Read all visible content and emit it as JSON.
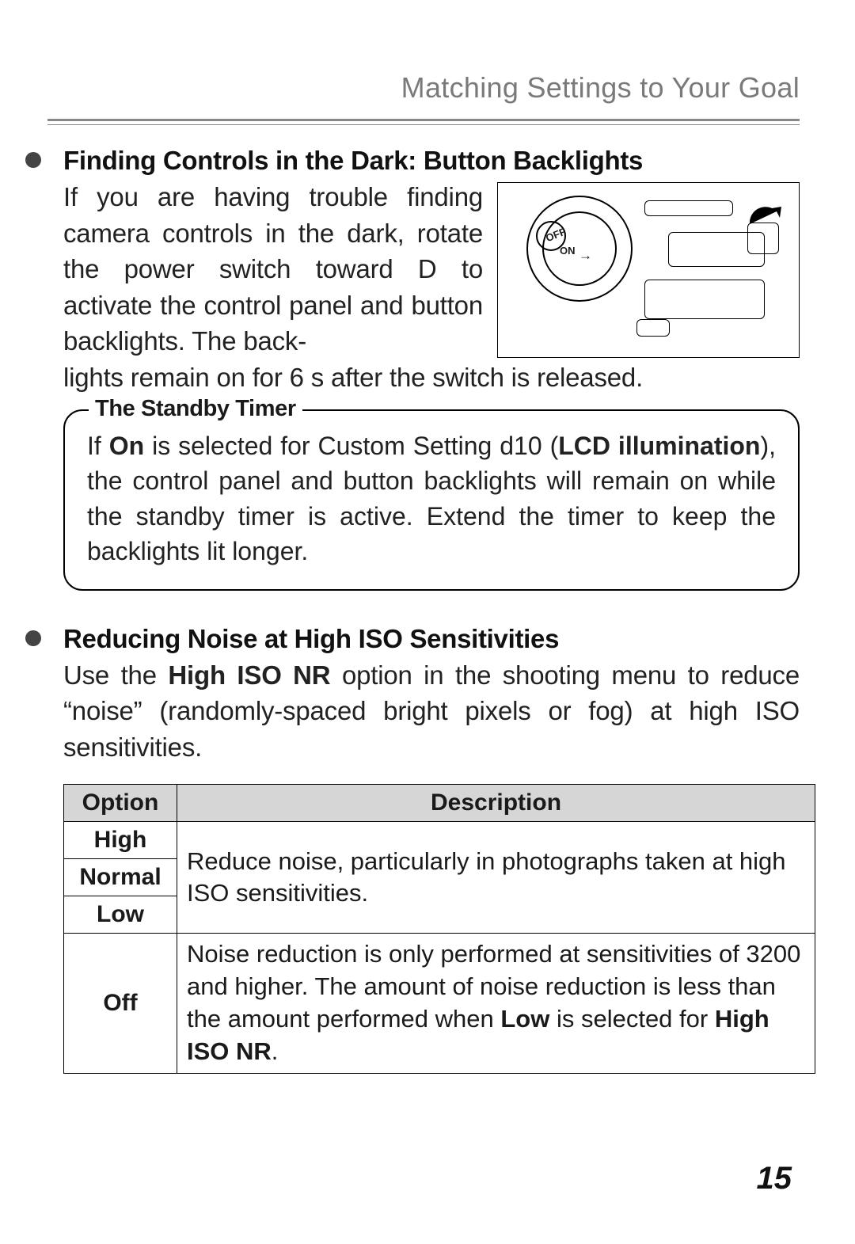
{
  "header": {
    "title": "Matching Settings to Your Goal"
  },
  "section1": {
    "title": "Finding Controls in the Dark: Button Backlights",
    "para1": "If you are having trouble finding camera controls in the dark, rotate the power switch toward D to activate the control panel and button backlights. The back-",
    "para2": "lights remain on for 6 s after the switch is released.",
    "fig_labels": {
      "off": "OFF",
      "on": "ON",
      "arrow": "→"
    }
  },
  "callout": {
    "title": "The Standby Timer",
    "body_pre": "If ",
    "body_on": "On",
    "body_mid": " is selected for Custom Setting d10 (",
    "body_lcd": "LCD illumination",
    "body_post": "), the control panel and button backlights will remain on while the standby timer is active. Extend the timer to keep the backlights lit longer."
  },
  "section2": {
    "title": "Reducing Noise at High ISO Sensitivities",
    "para_pre": "Use the ",
    "para_bold": "High ISO NR",
    "para_post": " option in the shooting menu to reduce “noise” (randomly-spaced bright pixels or fog) at high ISO sensitivities."
  },
  "table": {
    "head_option": "Option",
    "head_desc": "Description",
    "rows": {
      "high": "High",
      "normal": "Normal",
      "low": "Low",
      "off": "Off"
    },
    "desc_group": "Reduce noise, particularly in photographs taken at high ISO sensitivities.",
    "desc_off_1": "Noise reduction is only performed at sensitivities of 3200 and higher. The amount of noise reduction is less than the amount performed when ",
    "desc_off_low": "Low",
    "desc_off_2": " is selected for ",
    "desc_off_hiso": "High ISO NR",
    "desc_off_3": "."
  },
  "page_number": "15"
}
